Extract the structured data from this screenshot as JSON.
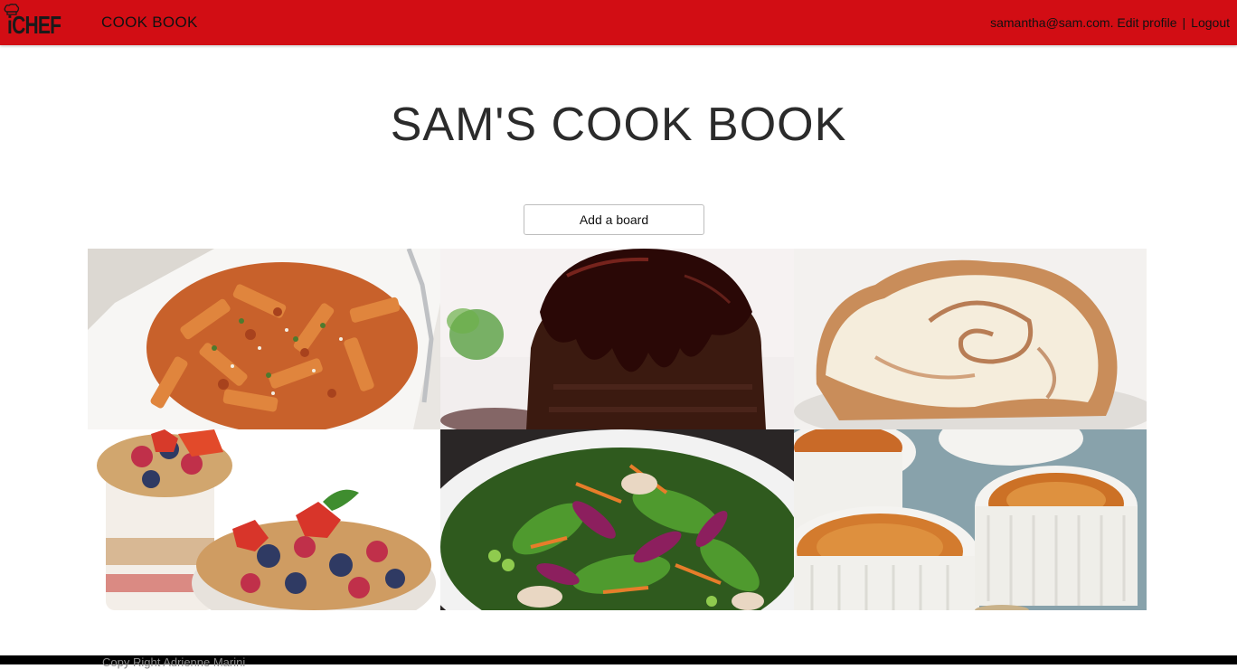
{
  "header": {
    "logo_text": "iCHEF",
    "nav_title": "COOK BOOK",
    "user_email": "samantha@sam.com.",
    "edit_profile": "Edit profile",
    "separator": "|",
    "logout": "Logout"
  },
  "main": {
    "title": "SAM'S COOK BOOK",
    "add_board_label": "Add a board",
    "boards": [
      {
        "name": "pasta-board",
        "icon": "penne-pasta-image"
      },
      {
        "name": "chocolate-cake-board",
        "icon": "chocolate-cake-image"
      },
      {
        "name": "cinnamon-roll-board",
        "icon": "cinnamon-roll-image"
      },
      {
        "name": "parfait-board",
        "icon": "berry-parfait-image"
      },
      {
        "name": "salad-board",
        "icon": "salad-image"
      },
      {
        "name": "creme-brulee-board",
        "icon": "creme-brulee-image"
      }
    ]
  },
  "footer": {
    "copyright": "Copy Right Adrienne Marini"
  },
  "colors": {
    "header_bg": "#d20d14",
    "footer_bg": "#000000",
    "title_text": "#2b2b2b"
  }
}
